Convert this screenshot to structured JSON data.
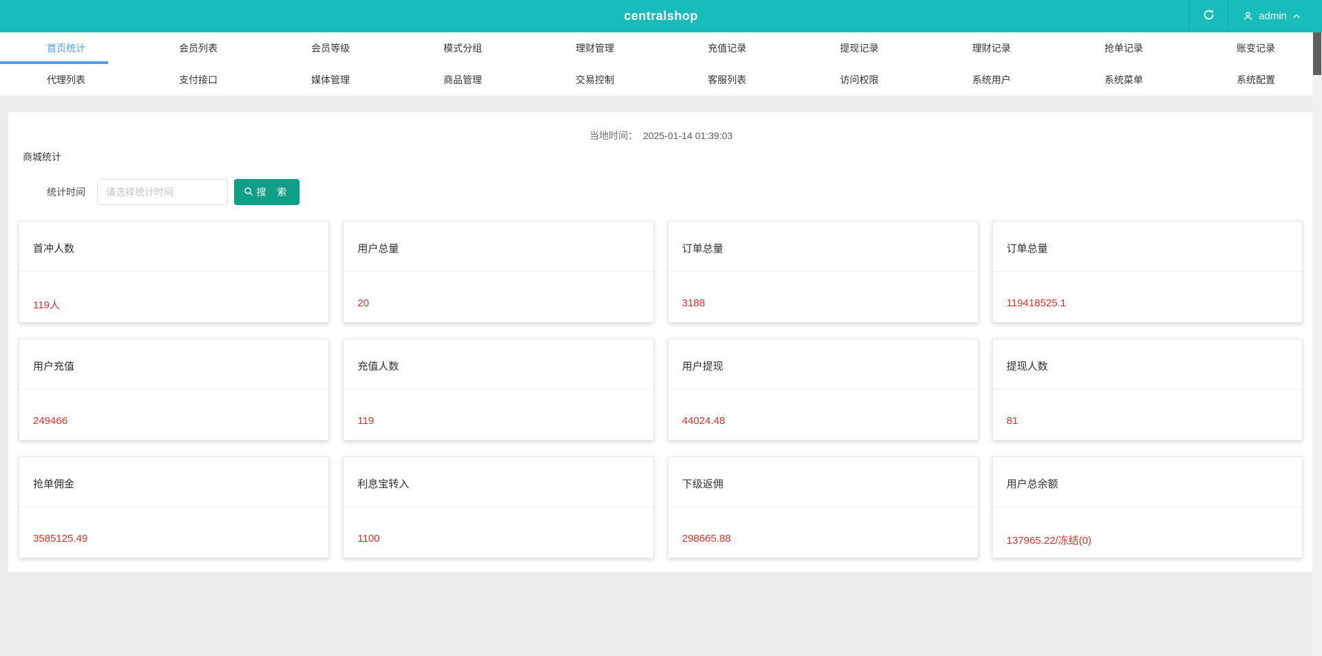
{
  "header": {
    "title": "centralshop",
    "username": "admin",
    "icons": {
      "refresh": "refresh-icon",
      "user": "user-icon",
      "dropdown": "chevron-up-icon"
    }
  },
  "nav": {
    "active_tab": "首页统计",
    "row1": [
      {
        "label": "首页统计"
      },
      {
        "label": "会员列表"
      },
      {
        "label": "会员等级"
      },
      {
        "label": "模式分组"
      },
      {
        "label": "理财管理"
      },
      {
        "label": "充值记录"
      },
      {
        "label": "提现记录"
      },
      {
        "label": "理财记录"
      },
      {
        "label": "抢单记录"
      },
      {
        "label": "账变记录"
      }
    ],
    "row2": [
      {
        "label": "代理列表"
      },
      {
        "label": "支付接口"
      },
      {
        "label": "媒体管理"
      },
      {
        "label": "商品管理"
      },
      {
        "label": "交易控制"
      },
      {
        "label": "客服列表"
      },
      {
        "label": "访问权限"
      },
      {
        "label": "系统用户"
      },
      {
        "label": "系统菜单"
      },
      {
        "label": "系统配置"
      }
    ]
  },
  "main": {
    "local_time_label": "当地时间：",
    "local_time_value": "2025-01-14 01:39:03",
    "section_title": "商城统计",
    "filter": {
      "label": "统计时间",
      "placeholder": "请选择统计时间",
      "input_value": "",
      "search_label": "搜 索",
      "search_icon": "search-icon"
    },
    "stats": [
      {
        "title": "首冲人数",
        "value": "119人"
      },
      {
        "title": "用户总量",
        "value": "20"
      },
      {
        "title": "订单总量",
        "value": "3188"
      },
      {
        "title": "订单总量",
        "value": "119418525.1"
      },
      {
        "title": "用户充值",
        "value": "249466"
      },
      {
        "title": "充值人数",
        "value": "119"
      },
      {
        "title": "用户提现",
        "value": "44024.48"
      },
      {
        "title": "提现人数",
        "value": "81"
      },
      {
        "title": "抢单佣金",
        "value": "3585125.49"
      },
      {
        "title": "利息宝转入",
        "value": "1100"
      },
      {
        "title": "下级返佣",
        "value": "298665.88"
      },
      {
        "title": "用户总余额",
        "value": "137965.22/冻结(0)"
      }
    ]
  },
  "colors": {
    "header_bg": "#18bcba",
    "active_tab_blue": "#4a9ff5",
    "stat_value_red": "#e62e29",
    "search_button_green": "#0f9e86",
    "page_bg": "#ececec"
  }
}
